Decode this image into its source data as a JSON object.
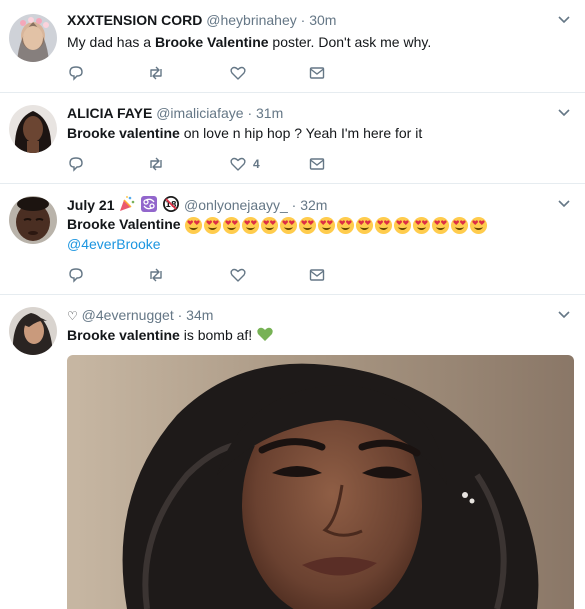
{
  "tweets": [
    {
      "name": "XXXTENSION CORD",
      "handle": "@heybrinahey",
      "time": "30m",
      "text_before": "My dad has a ",
      "text_bold": "Brooke Valentine",
      "text_after": " poster. Don't ask me why.",
      "likes": ""
    },
    {
      "name": "ALICIA FAYE",
      "handle": "@imaliciafaye",
      "time": "31m",
      "text_bold": "Brooke valentine",
      "text_after": " on love n hip hop ? Yeah I'm here for it",
      "likes": "4"
    },
    {
      "name": "July 21",
      "name_emojis": [
        "party-popper",
        "cancer-zodiac",
        "no-under-18"
      ],
      "handle": "@onlyonejaayy_",
      "time": "32m",
      "text_bold": "Brooke Valentine",
      "emoji_count": 16,
      "emoji_name": "smiling-face-with-heart-eyes",
      "mention": "@4everBrooke",
      "likes": ""
    },
    {
      "name_prefix": "♡",
      "handle": "@4evernugget",
      "time": "34m",
      "text_bold": "Brooke valentine",
      "text_after": " is bomb af!",
      "trailing_emoji": "green-heart",
      "image": "photo of a woman with long dark wavy hair"
    }
  ],
  "separator": "·",
  "colors": {
    "name": "#14171a",
    "meta": "#657786",
    "link": "#1b95e0",
    "divider": "#e6ecf0",
    "green_heart": "#77b255",
    "heart_eyes_face": "#ffcc4d",
    "heart_eyes_hearts": "#dd2e44"
  }
}
